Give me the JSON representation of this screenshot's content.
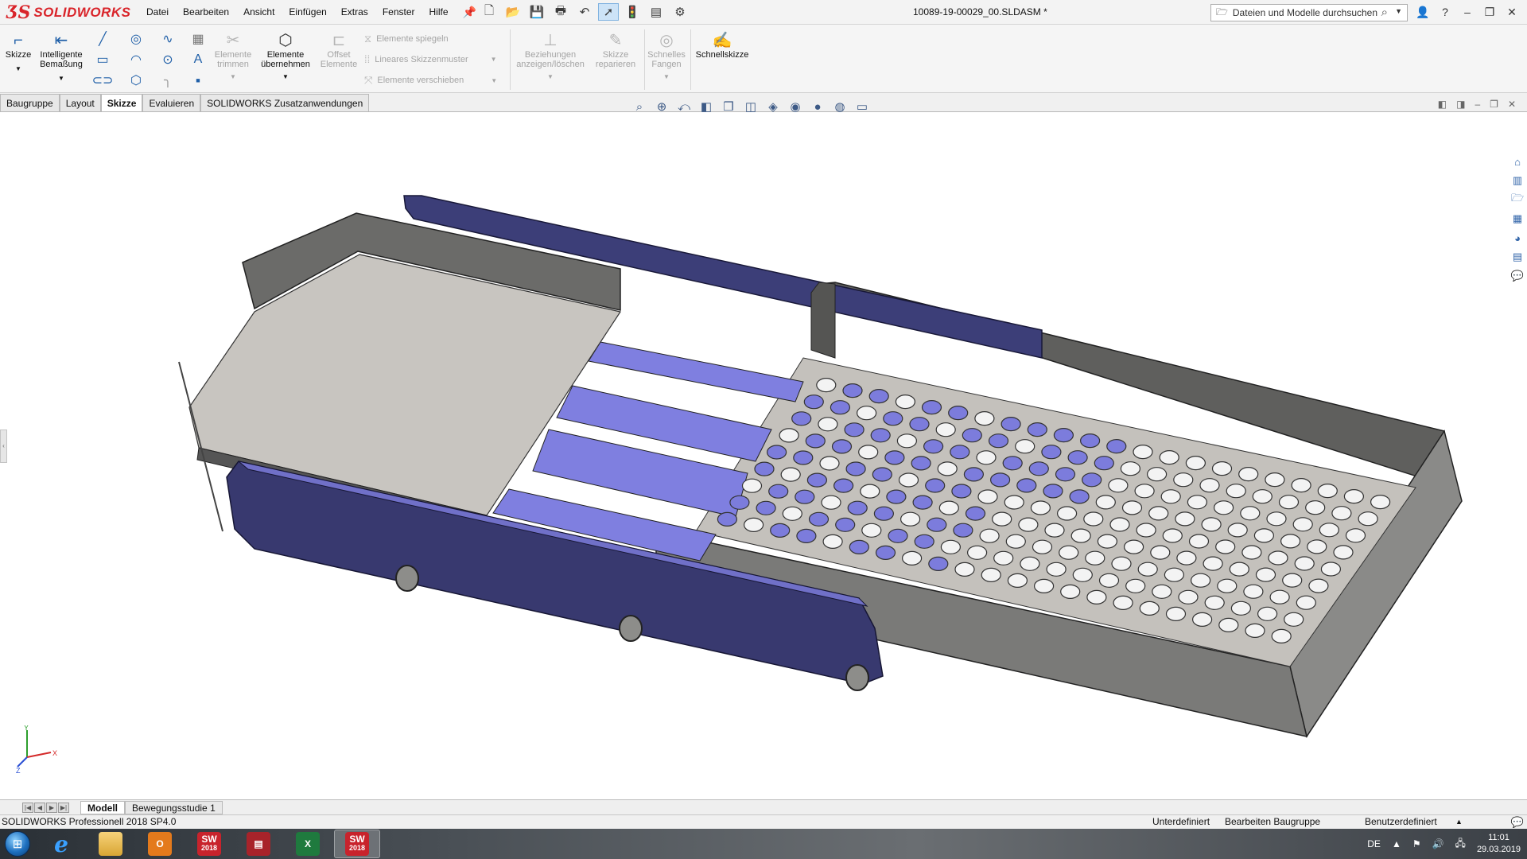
{
  "app": {
    "logo_mark": "ƷS",
    "logo_text": "SOLIDWORKS",
    "document_title": "10089-19-00029_00.SLDASM *"
  },
  "menu": [
    "Datei",
    "Bearbeiten",
    "Ansicht",
    "Einfügen",
    "Extras",
    "Fenster",
    "Hilfe"
  ],
  "search": {
    "placeholder": "Dateien und Modelle durchsuchen"
  },
  "commandmanager": {
    "skizze": "Skizze",
    "intelligente_1": "Intelligente",
    "intelligente_2": "Bemaßung",
    "trimmen_1": "Elemente",
    "trimmen_2": "trimmen",
    "uebernehmen_1": "Elemente",
    "uebernehmen_2": "übernehmen",
    "offset_1": "Offset",
    "offset_2": "Elemente",
    "spiegeln": "Elemente spiegeln",
    "muster": "Lineares Skizzenmuster",
    "verschieben": "Elemente verschieben",
    "beziehungen_1": "Beziehungen",
    "beziehungen_2": "anzeigen/löschen",
    "reparieren_1": "Skizze",
    "reparieren_2": "reparieren",
    "fangen_1": "Schnelles",
    "fangen_2": "Fangen",
    "schnellskizze": "Schnellskizze"
  },
  "tabs": [
    {
      "label": "Baugruppe"
    },
    {
      "label": "Layout"
    },
    {
      "label": "Skizze",
      "active": true
    },
    {
      "label": "Evaluieren"
    },
    {
      "label": "SOLIDWORKS Zusatzanwendungen"
    }
  ],
  "bottom_tabs": [
    {
      "label": "Modell",
      "active": true
    },
    {
      "label": "Bewegungsstudie 1"
    }
  ],
  "triad": {
    "x": "X",
    "y": "Y",
    "z": "Z"
  },
  "status": {
    "product": "SOLIDWORKS Professionell 2018 SP4.0",
    "definition": "Unterdefiniert",
    "mode": "Bearbeiten Baugruppe",
    "units": "Benutzerdefiniert",
    "units_caret": "▲"
  },
  "taskbar": {
    "apps": [
      "Internet Explorer",
      "Windows Explorer",
      "Outlook",
      "SOLIDWORKS 2018",
      "Acrobat",
      "Excel",
      "SOLIDWORKS 2018"
    ],
    "sw_label_1": "SW",
    "sw_label_2": "2018",
    "lang": "DE",
    "time": "11:01",
    "date": "29.03.2019"
  },
  "colors": {
    "accent": "#d9242a",
    "part_blue": "#3b3c78",
    "bar_blue": "#7f7fe0",
    "sheet_gray": "#c5c2bd",
    "tray_gray": "#6f6f6d"
  }
}
